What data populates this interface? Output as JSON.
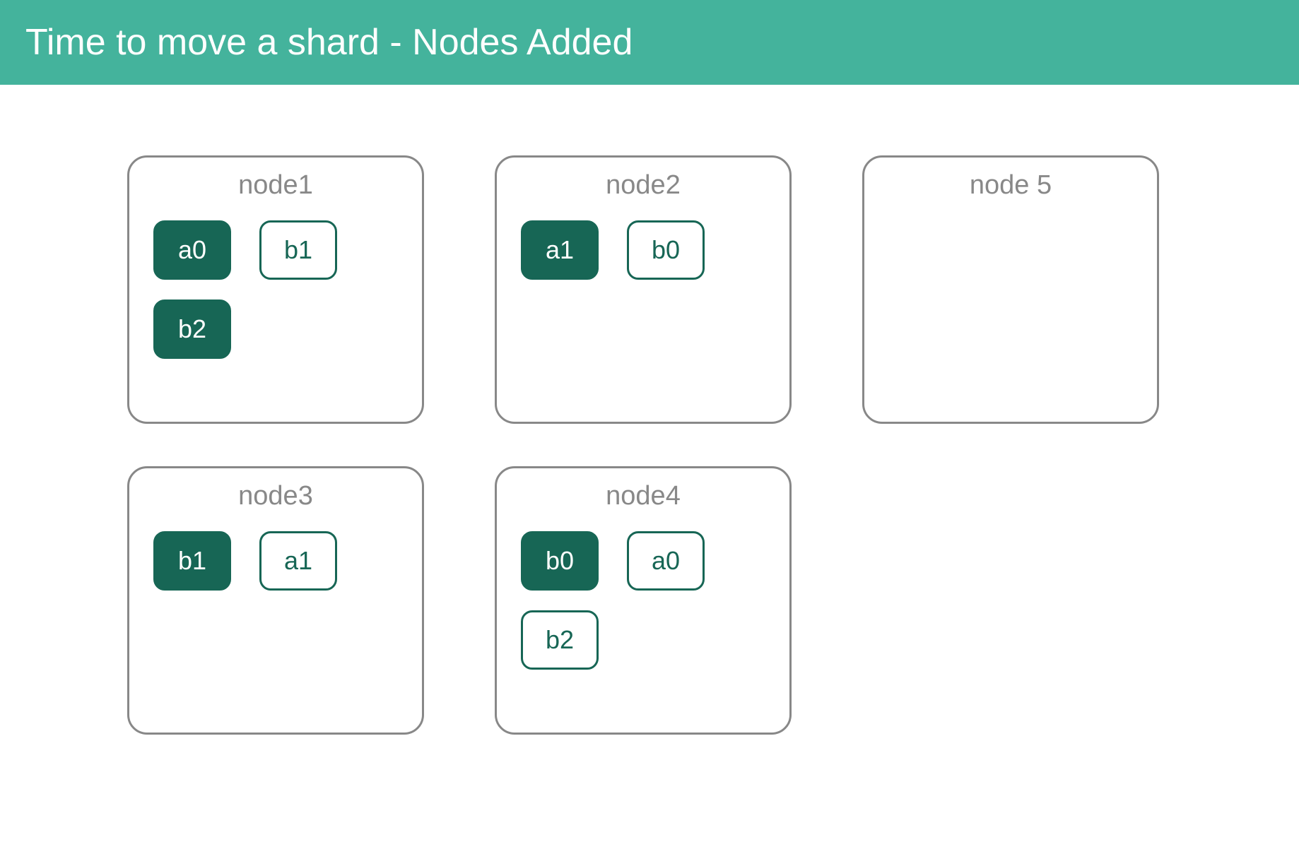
{
  "header": {
    "title": "Time to move a shard - Nodes Added"
  },
  "nodes": [
    {
      "label": "node1",
      "shards": [
        {
          "id": "a0",
          "type": "primary"
        },
        {
          "id": "b1",
          "type": "replica"
        },
        {
          "id": "b2",
          "type": "primary"
        }
      ]
    },
    {
      "label": "node2",
      "shards": [
        {
          "id": "a1",
          "type": "primary"
        },
        {
          "id": "b0",
          "type": "replica"
        }
      ]
    },
    {
      "label": "node 5",
      "shards": []
    },
    {
      "label": "node3",
      "shards": [
        {
          "id": "b1",
          "type": "primary"
        },
        {
          "id": "a1",
          "type": "replica"
        }
      ]
    },
    {
      "label": "node4",
      "shards": [
        {
          "id": "b0",
          "type": "primary"
        },
        {
          "id": "a0",
          "type": "replica"
        },
        {
          "id": "b2",
          "type": "replica"
        }
      ]
    }
  ]
}
